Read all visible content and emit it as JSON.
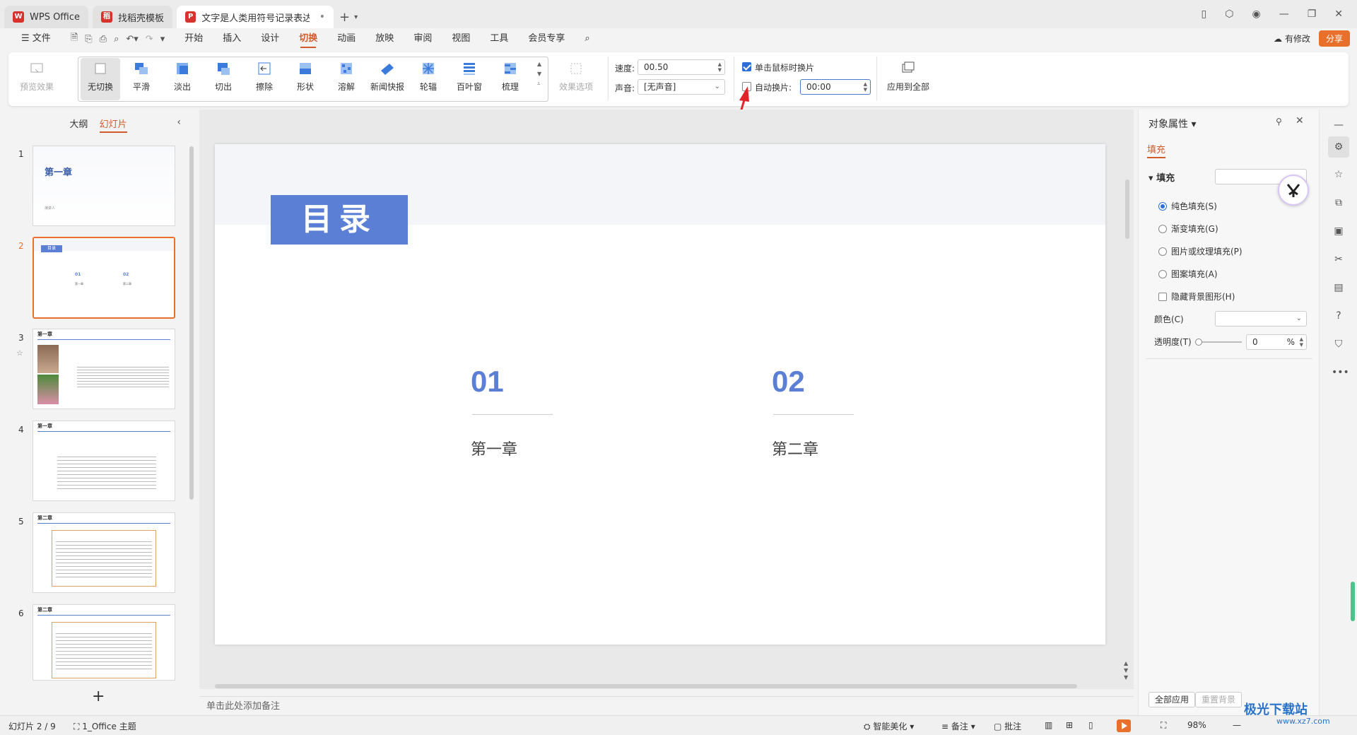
{
  "tabs": [
    {
      "label": "WPS Office",
      "logo_color": "#d8322c"
    },
    {
      "label": "找稻壳模板",
      "logo_color": "#d8322c"
    },
    {
      "label": "文字是人类用符号记录表达信息以",
      "logo_color": "#d8322c"
    }
  ],
  "menu": {
    "file": "文件",
    "items": [
      "开始",
      "插入",
      "设计",
      "切换",
      "动画",
      "放映",
      "审阅",
      "视图",
      "工具",
      "会员专享"
    ],
    "active": "切换",
    "revise": "有修改",
    "share": "分享"
  },
  "ribbon": {
    "preview": "预览效果",
    "transitions": [
      "无切换",
      "平滑",
      "淡出",
      "切出",
      "擦除",
      "形状",
      "溶解",
      "新闻快报",
      "轮辐",
      "百叶窗",
      "梳理"
    ],
    "selected_transition": "无切换",
    "effect_options": "效果选项",
    "speed_label": "速度:",
    "speed_value": "00.50",
    "sound_label": "声音:",
    "sound_value": "[无声音]",
    "click_advance_label": "单击鼠标时换片",
    "click_advance_checked": true,
    "auto_advance_label": "自动换片:",
    "auto_advance_checked": false,
    "auto_advance_value": "00:00",
    "apply_all": "应用到全部"
  },
  "left_panel": {
    "tab_outline": "大纲",
    "tab_slides": "幻灯片",
    "active_tab": "幻灯片",
    "slides": [
      {
        "num": "1",
        "title": "第一章",
        "sub": "演讲人"
      },
      {
        "num": "2",
        "title": "目录",
        "items": [
          "01",
          "02"
        ],
        "labels": [
          "第一章",
          "第二章"
        ]
      },
      {
        "num": "3",
        "title": "第一章"
      },
      {
        "num": "4",
        "title": "第一章"
      },
      {
        "num": "5",
        "title": "第二章"
      },
      {
        "num": "6",
        "title": "第二章"
      }
    ],
    "selected": "2"
  },
  "slide": {
    "title": "目录",
    "items": [
      {
        "num": "01",
        "label": "第一章"
      },
      {
        "num": "02",
        "label": "第二章"
      }
    ],
    "accent": "#5b7fd4"
  },
  "notes_placeholder": "单击此处添加备注",
  "right_panel": {
    "title": "对象属性",
    "tab": "填充",
    "section": "填充",
    "options": [
      "纯色填充(S)",
      "渐变填充(G)",
      "图片或纹理填充(P)",
      "图案填充(A)"
    ],
    "selected_option": "纯色填充(S)",
    "hide_bg": "隐藏背景图形(H)",
    "color_label": "颜色(C)",
    "transparency_label": "透明度(T)",
    "transparency_value": "0",
    "transparency_unit": "%",
    "apply_all": "全部应用",
    "reset_bg": "重置背景"
  },
  "statusbar": {
    "slide_info": "幻灯片 2 / 9",
    "theme": "1_Office 主题",
    "smart": "智能美化",
    "notes": "备注",
    "comments": "批注",
    "zoom": "98%"
  },
  "watermark": {
    "text": "极光下载站",
    "url": "www.xz7.com"
  }
}
